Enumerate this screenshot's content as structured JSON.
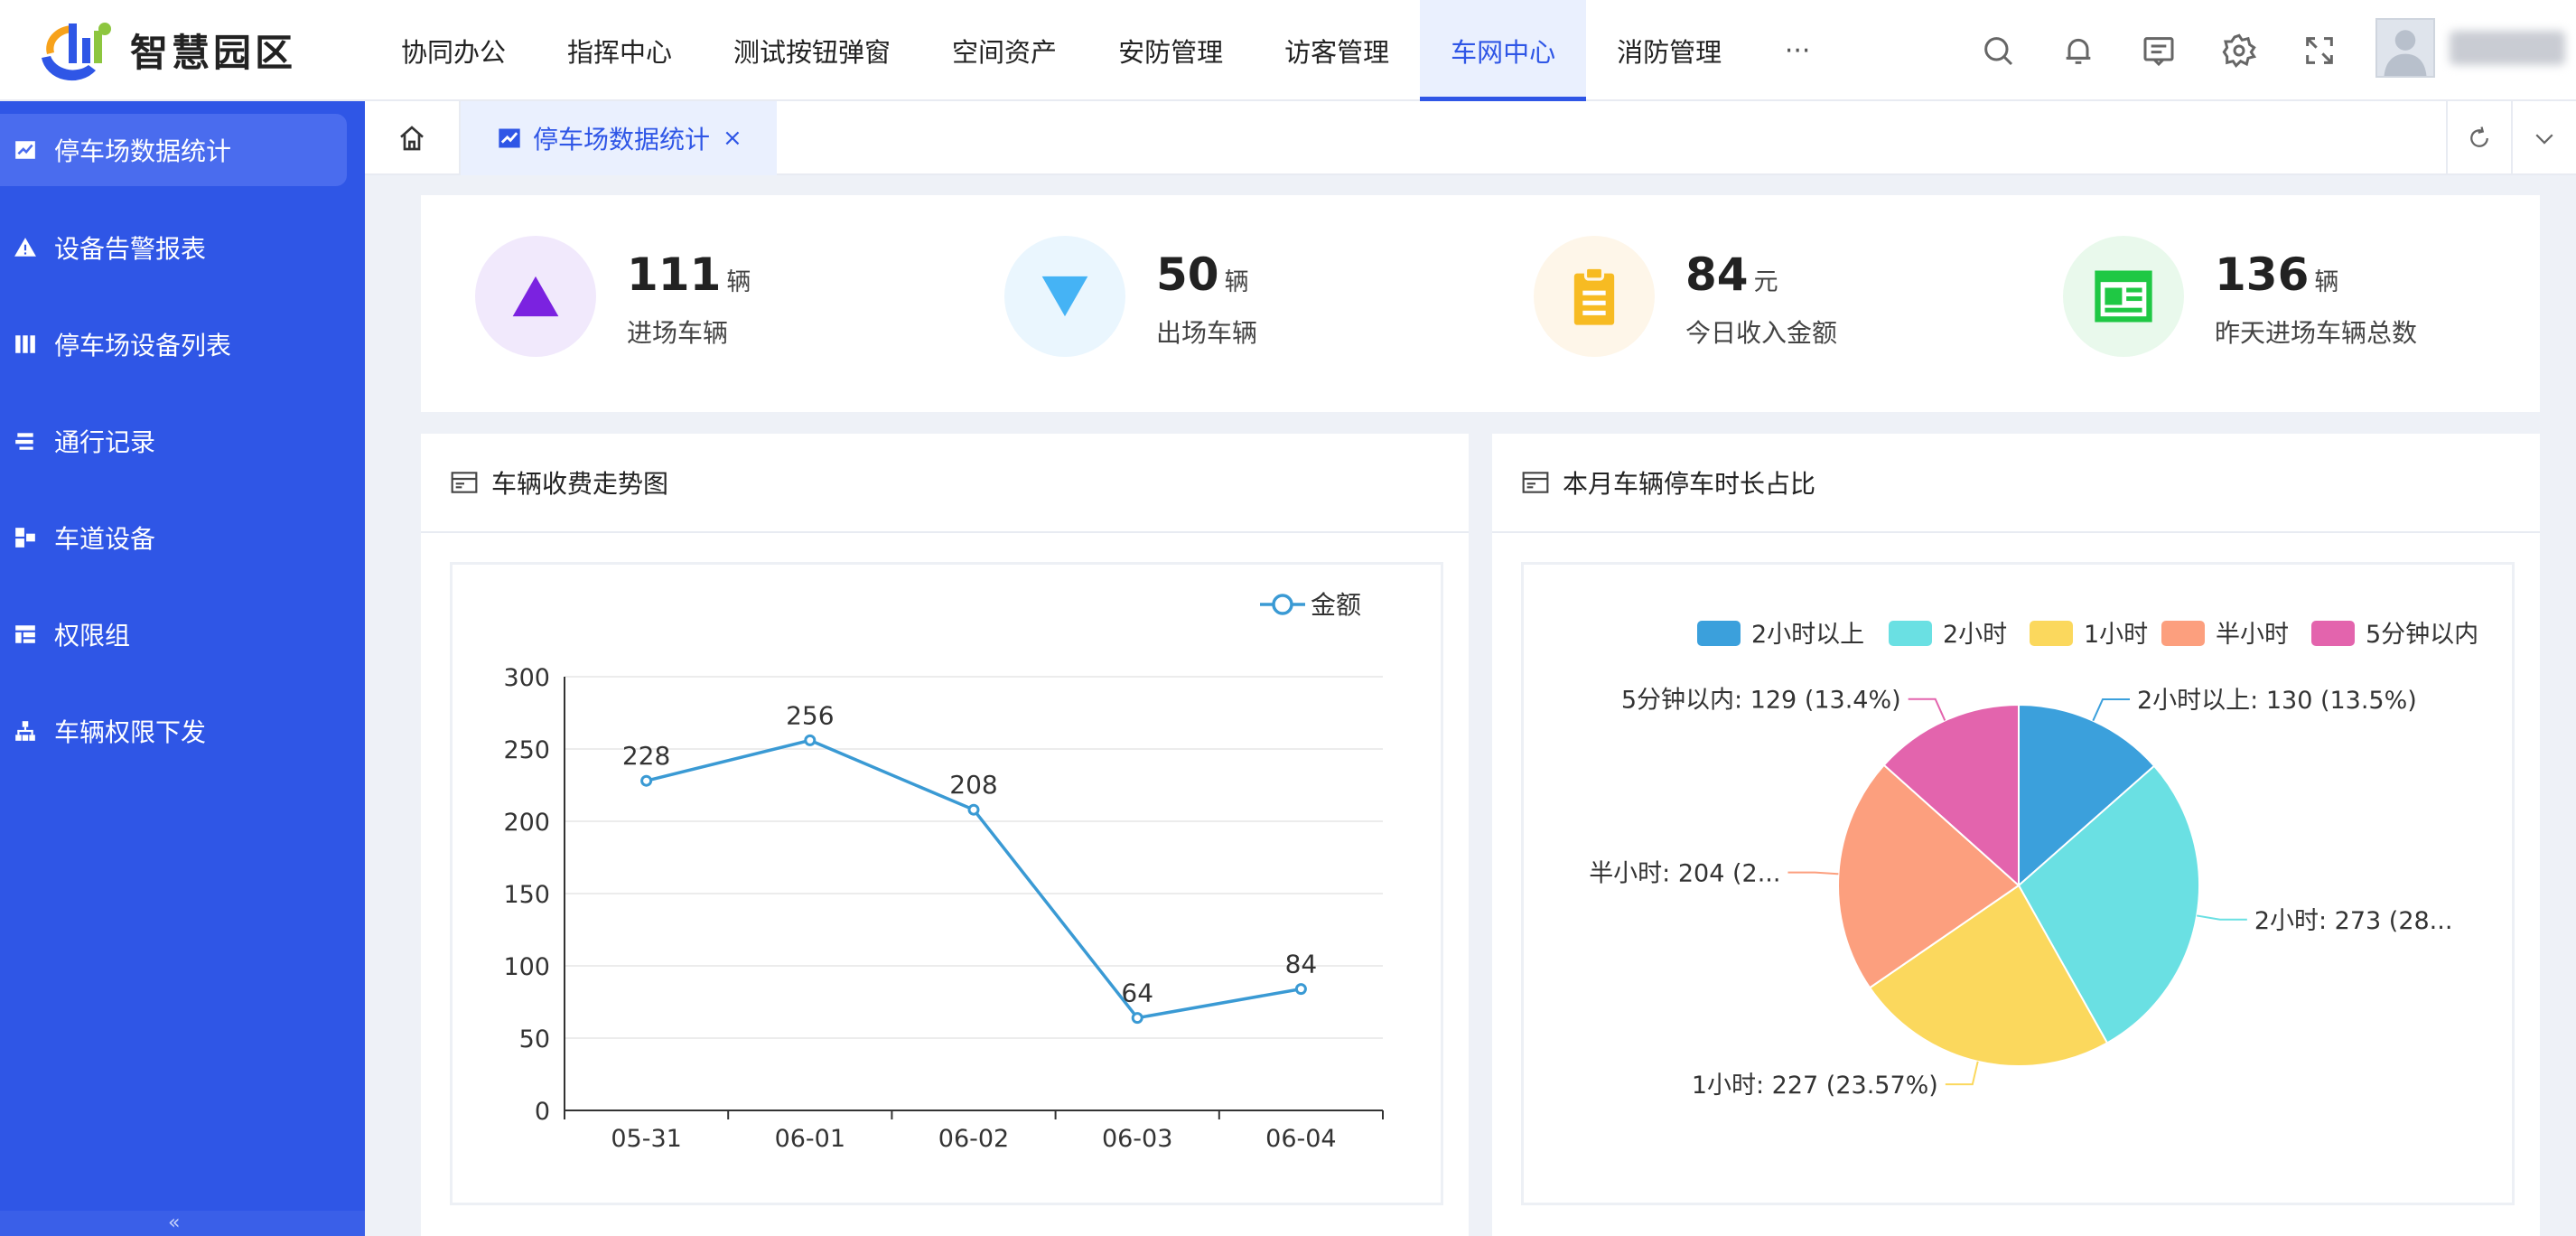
{
  "app": {
    "title": "智慧园区"
  },
  "nav": {
    "items": [
      "协同办公",
      "指挥中心",
      "测试按钮弹窗",
      "空间资产",
      "安防管理",
      "访客管理",
      "车网中心",
      "消防管理"
    ],
    "active_index": 6,
    "more": "···"
  },
  "header_icons": [
    "search-icon",
    "bell-icon",
    "message-icon",
    "gear-icon",
    "fullscreen-icon"
  ],
  "user": {
    "avatar": "avatar-icon"
  },
  "sidebar": {
    "items": [
      {
        "label": "停车场数据统计",
        "icon": "chart-icon",
        "active": true
      },
      {
        "label": "设备告警报表",
        "icon": "warning-icon"
      },
      {
        "label": "停车场设备列表",
        "icon": "columns-icon"
      },
      {
        "label": "通行记录",
        "icon": "hand-icon"
      },
      {
        "label": "车道设备",
        "icon": "lane-icon"
      },
      {
        "label": "权限组",
        "icon": "table-icon"
      },
      {
        "label": "车辆权限下发",
        "icon": "tree-icon"
      }
    ],
    "collapse": "«"
  },
  "tabs": {
    "home_icon": "home-icon",
    "active": {
      "label": "停车场数据统计",
      "close": "×"
    },
    "tools": [
      "refresh-icon",
      "chevron-down-icon"
    ]
  },
  "stats": [
    {
      "value": "111",
      "unit": "辆",
      "label": "进场车辆",
      "color": "#7b22e0",
      "bg": "#f1e9fc",
      "icon": "triangle-up-icon"
    },
    {
      "value": "50",
      "unit": "辆",
      "label": "出场车辆",
      "color": "#45b3f5",
      "bg": "#eaf6fe",
      "icon": "triangle-down-icon"
    },
    {
      "value": "84",
      "unit": "元",
      "label": "今日收入金额",
      "color": "#f7bb22",
      "bg": "#fef6e9",
      "icon": "clipboard-icon"
    },
    {
      "value": "136",
      "unit": "辆",
      "label": "昨天进场车辆总数",
      "color": "#1fc844",
      "bg": "#e9f9ec",
      "icon": "news-icon"
    }
  ],
  "panels": {
    "line": {
      "title": "车辆收费走势图"
    },
    "pie": {
      "title": "本月车辆停车时长占比"
    }
  },
  "chart_data": [
    {
      "type": "line",
      "categories": [
        "05-31",
        "06-01",
        "06-02",
        "06-03",
        "06-04"
      ],
      "series": [
        {
          "name": "金额",
          "values": [
            228,
            256,
            208,
            64,
            84
          ]
        }
      ],
      "ylim": [
        0,
        300
      ],
      "yticks": [
        0,
        50,
        100,
        150,
        200,
        250,
        300
      ],
      "grid": true,
      "legend": "top-right",
      "color": "#3a9ad4"
    },
    {
      "type": "pie",
      "legend": "top",
      "slices": [
        {
          "name": "2小时以上",
          "value": 130,
          "label": "2小时以上: 130 (13.5%)",
          "color": "#3ba0dc"
        },
        {
          "name": "2小时",
          "value": 273,
          "label": "2小时: 273 (28...",
          "color": "#6ae0e3"
        },
        {
          "name": "1小时",
          "value": 227,
          "label": "1小时: 227 (23.57%)",
          "color": "#fbd85d"
        },
        {
          "name": "半小时",
          "value": 204,
          "label": "半小时: 204 (2...",
          "color": "#fc9f7e"
        },
        {
          "name": "5分钟以内",
          "value": 129,
          "label": "5分钟以内: 129 (13.4%)",
          "color": "#e364ad"
        }
      ]
    }
  ]
}
